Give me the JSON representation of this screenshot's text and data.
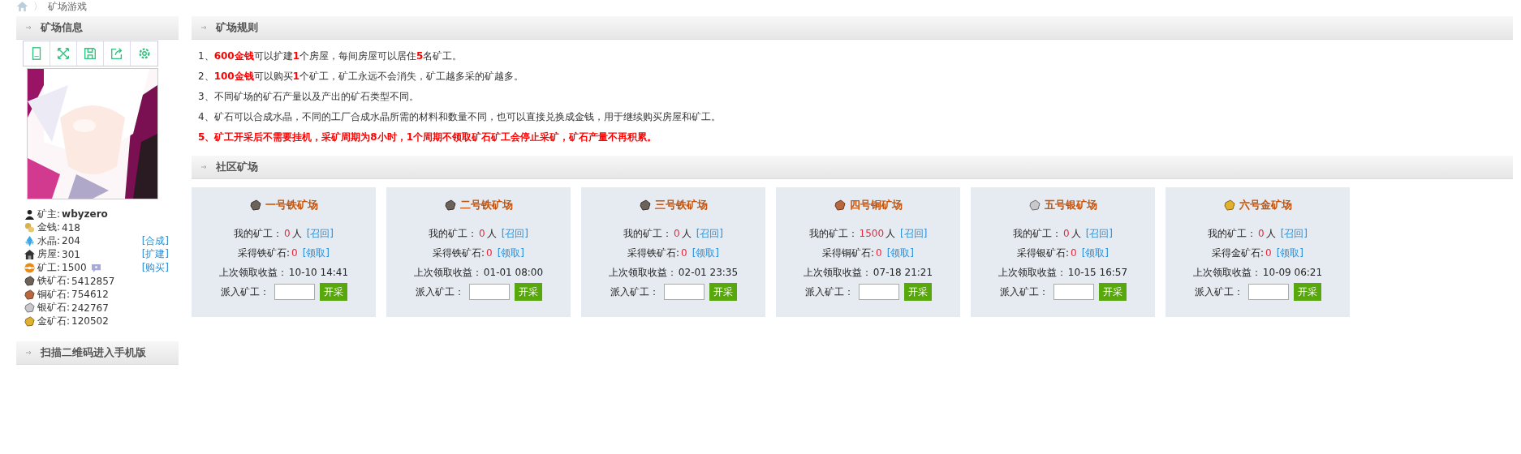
{
  "breadcrumb": {
    "separator": "〉",
    "current": "矿场游戏"
  },
  "sidebar": {
    "title": "矿场信息",
    "toolbar_icons": [
      {
        "kind": "tablet"
      },
      {
        "kind": "fullscreen"
      },
      {
        "kind": "save"
      },
      {
        "kind": "share"
      },
      {
        "kind": "settings"
      }
    ],
    "stats": [
      {
        "kind": "user",
        "label": "矿主:",
        "value": "wbyzero",
        "bold": true,
        "help": false
      },
      {
        "kind": "coins",
        "label": "金钱:",
        "value": "418",
        "bold": false,
        "help": false
      },
      {
        "kind": "crystal",
        "label": "水晶:",
        "value": "204",
        "bold": false,
        "help": false,
        "link": "[合成]"
      },
      {
        "kind": "house",
        "label": "房屋:",
        "value": "301",
        "bold": false,
        "help": false,
        "link": "[扩建]"
      },
      {
        "kind": "miner",
        "label": "矿工:",
        "value": "1500",
        "bold": false,
        "help": true,
        "link": "[购买]"
      },
      {
        "kind": "iron",
        "label": "铁矿石:",
        "value": "5412857",
        "bold": false,
        "help": false
      },
      {
        "kind": "copper",
        "label": "铜矿石:",
        "value": "754612",
        "bold": false,
        "help": false
      },
      {
        "kind": "silver",
        "label": "银矿石:",
        "value": "242767",
        "bold": false,
        "help": false
      },
      {
        "kind": "gold",
        "label": "金矿石:",
        "value": "120502",
        "bold": false,
        "help": false
      }
    ],
    "qr_title": "扫描二维码进入手机版"
  },
  "rules": {
    "title": "矿场规则",
    "items": [
      {
        "text": "1、**600金钱**可以扩建**1**个房屋，每间房屋可以居住**5**名矿工。"
      },
      {
        "text": "2、**100金钱**可以购买**1**个矿工，矿工永远不会消失，矿工越多采的矿越多。"
      },
      {
        "text": "3、不同矿场的矿石产量以及产出的矿石类型不同。"
      },
      {
        "text": "4、矿石可以合成水晶，不同的工厂合成水晶所需的材料和数量不同，也可以直接兑换成金钱，用于继续购买房屋和矿工。"
      },
      {
        "text": "**5、矿工开采后不需要挂机，采矿周期为8小时，1个周期不领取矿石矿工会停止采矿，矿石产量不再积累。**"
      }
    ]
  },
  "community": {
    "title": "社区矿场",
    "mines": [
      {
        "kind": "iron",
        "title": "一号铁矿场",
        "miners_label": "我的矿工：",
        "miners": "0",
        "unit": "人",
        "recall": "[召回]",
        "ore_label": "采得铁矿石:",
        "ore_amount": "0",
        "collect": "[领取]",
        "last_label": "上次领取收益：",
        "last": "10-10 14:41",
        "dispatch_label": "派入矿工：",
        "button": "开采"
      },
      {
        "kind": "iron",
        "title": "二号铁矿场",
        "miners_label": "我的矿工：",
        "miners": "0",
        "unit": "人",
        "recall": "[召回]",
        "ore_label": "采得铁矿石:",
        "ore_amount": "0",
        "collect": "[领取]",
        "last_label": "上次领取收益：",
        "last": "01-01 08:00",
        "dispatch_label": "派入矿工：",
        "button": "开采"
      },
      {
        "kind": "iron",
        "title": "三号铁矿场",
        "miners_label": "我的矿工：",
        "miners": "0",
        "unit": "人",
        "recall": "[召回]",
        "ore_label": "采得铁矿石:",
        "ore_amount": "0",
        "collect": "[领取]",
        "last_label": "上次领取收益：",
        "last": "02-01 23:35",
        "dispatch_label": "派入矿工：",
        "button": "开采"
      },
      {
        "kind": "copper",
        "title": "四号铜矿场",
        "miners_label": "我的矿工：",
        "miners": "1500",
        "unit": "人",
        "recall": "[召回]",
        "ore_label": "采得铜矿石:",
        "ore_amount": "0",
        "collect": "[领取]",
        "last_label": "上次领取收益：",
        "last": "07-18 21:21",
        "dispatch_label": "派入矿工：",
        "button": "开采"
      },
      {
        "kind": "silver",
        "title": "五号银矿场",
        "miners_label": "我的矿工：",
        "miners": "0",
        "unit": "人",
        "recall": "[召回]",
        "ore_label": "采得银矿石:",
        "ore_amount": "0",
        "collect": "[领取]",
        "last_label": "上次领取收益：",
        "last": "10-15 16:57",
        "dispatch_label": "派入矿工：",
        "button": "开采"
      },
      {
        "kind": "gold",
        "title": "六号金矿场",
        "miners_label": "我的矿工：",
        "miners": "0",
        "unit": "人",
        "recall": "[召回]",
        "ore_label": "采得金矿石:",
        "ore_amount": "0",
        "collect": "[领取]",
        "last_label": "上次领取收益：",
        "last": "10-09 06:21",
        "dispatch_label": "派入矿工：",
        "button": "开采"
      }
    ]
  }
}
